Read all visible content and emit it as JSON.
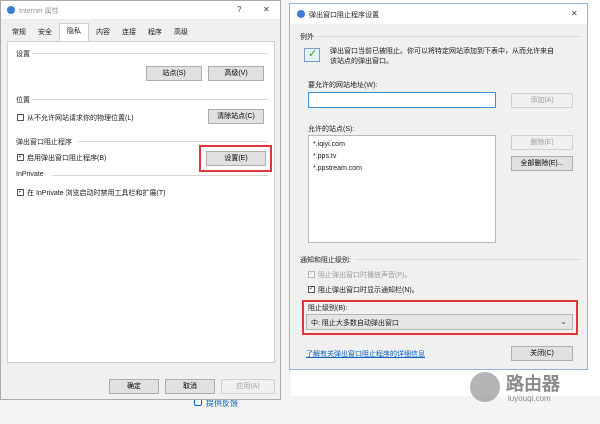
{
  "ie_options": {
    "title": "Internet 属性",
    "help_glyph": "?",
    "close_glyph": "✕",
    "tabs": [
      "常规",
      "安全",
      "隐私",
      "内容",
      "连接",
      "程序",
      "高级"
    ],
    "active_tab": "隐私",
    "settings_group": "设置",
    "sites_button": "站点(S)",
    "advanced_button": "高级(V)",
    "location_group": "位置",
    "location_checkbox": "从不允许网站请求你的物理位置(L)",
    "clear_sites_button": "清除站点(C)",
    "popup_group": "弹出窗口阻止程序",
    "popup_checkbox": "启用弹出窗口阻止程序(B)",
    "popup_settings_button": "设置(E)",
    "inprivate_group": "InPrivate",
    "inprivate_checkbox": "在 InPrivate 浏览启动时禁用工具栏和扩展(T)",
    "ok_button": "确定",
    "cancel_button": "取消",
    "apply_button": "应用(A)"
  },
  "popup_dialog": {
    "title": "弹出窗口阻止程序设置",
    "close_glyph": "✕",
    "exceptions_group": "例外",
    "info_text_line1": "弹出窗口当前已被阻止。你可以将特定网站添加到下表中，从而允许来自",
    "info_text_line2": "该站点的弹出窗口。",
    "address_label": "要允许的网站地址(W):",
    "address_value": "",
    "add_button": "添加(A)",
    "allowed_label": "允许的站点(S):",
    "allowed_sites": [
      "*.iqiyi.com",
      "*.pps.tv",
      "*.ppstream.com"
    ],
    "remove_button": "删除(E)",
    "remove_all_button": "全部删除(E)...",
    "notify_group": "通知和阻止级别:",
    "sound_checkbox": "阻止弹出窗口时播放声音(P)。",
    "bar_checkbox": "阻止弹出窗口时显示通知栏(N)。",
    "block_level_label": "阻止级别(B):",
    "block_level_value": "中: 阻止大多数自动弹出窗口",
    "learn_more_link": "了解有关弹出窗口阻止程序的详细信息",
    "close_button": "关闭(C)"
  },
  "background": {
    "feedback_link": "提供反馈",
    "watermark_title": "路由器",
    "watermark_subtitle": "luyouqi.com"
  },
  "colors": {
    "highlight_border": "#e0363b",
    "link": "#0a5fc4",
    "combo_bg": "#e5e5e5"
  }
}
